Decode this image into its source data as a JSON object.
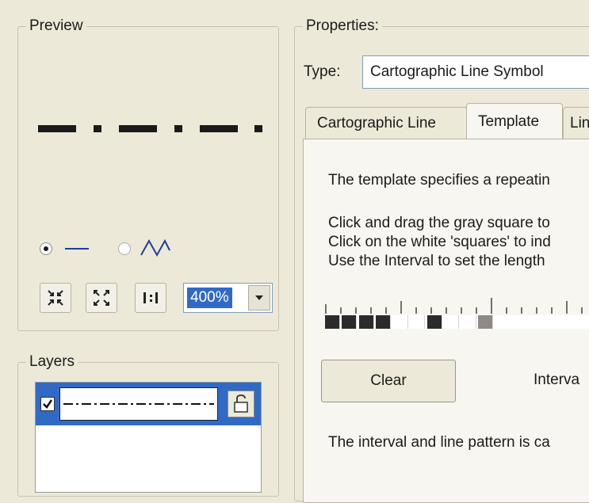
{
  "preview": {
    "title": "Preview",
    "zoom_value": "400%",
    "toolbar": [
      "shrink",
      "fit",
      "actual-size"
    ]
  },
  "layers": {
    "title": "Layers",
    "items": [
      {
        "checked": true,
        "locked": false
      }
    ]
  },
  "properties": {
    "title": "Properties:",
    "type_label": "Type:",
    "type_value": "Cartographic Line Symbol",
    "tabs": [
      "Cartographic Line",
      "Template",
      "Lin"
    ],
    "active_tab": "Template",
    "description": "The template specifies a repeatin",
    "instructions": [
      "Click and drag the gray square to",
      "Click on the white 'squares' to ind",
      "Use the Interval to set the length"
    ],
    "template_cells": [
      "filled",
      "filled",
      "filled",
      "filled",
      "empty",
      "empty",
      "filled",
      "empty",
      "empty",
      "gray",
      "empty",
      "empty",
      "empty",
      "empty",
      "empty",
      "empty"
    ],
    "clear_label": "Clear",
    "interval_label": "Interva",
    "footer_text": "The interval and line pattern is ca"
  },
  "colors": {
    "background": "#ece9d8",
    "selection": "#316ac5",
    "filled_cell": "#2b2b2b",
    "gray_cell": "#8f8a88"
  }
}
